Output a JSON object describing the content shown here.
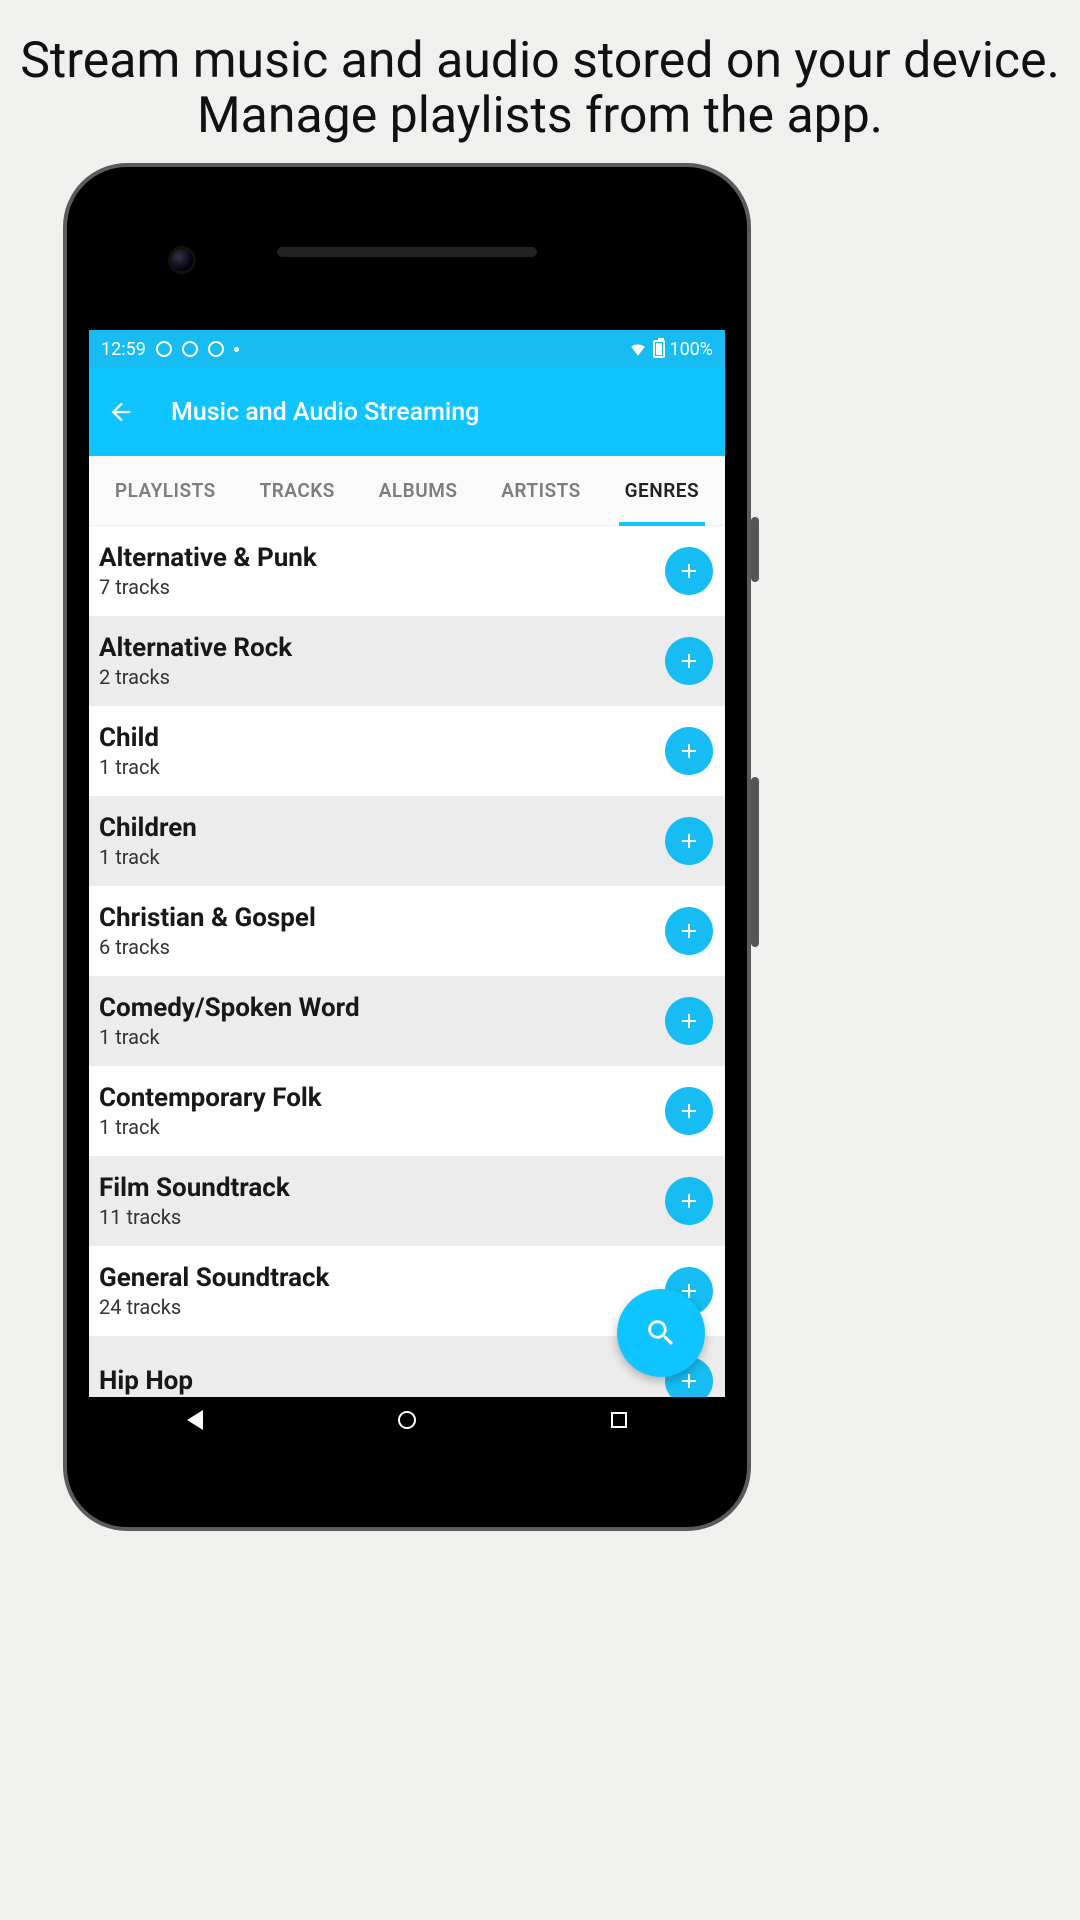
{
  "promo": "Stream music and audio stored on your device. Manage playlists from the app.",
  "statusbar": {
    "time": "12:59",
    "battery": "100%"
  },
  "appbar": {
    "title": "Music and Audio Streaming"
  },
  "tabs": [
    {
      "label": "PLAYLISTS",
      "active": false
    },
    {
      "label": "TRACKS",
      "active": false
    },
    {
      "label": "ALBUMS",
      "active": false
    },
    {
      "label": "ARTISTS",
      "active": false
    },
    {
      "label": "GENRES",
      "active": true
    }
  ],
  "genres": [
    {
      "name": "Alternative & Punk",
      "sub": "7 tracks"
    },
    {
      "name": "Alternative Rock",
      "sub": "2 tracks"
    },
    {
      "name": "Child",
      "sub": "1 track"
    },
    {
      "name": "Children",
      "sub": "1 track"
    },
    {
      "name": "Christian & Gospel",
      "sub": "6 tracks"
    },
    {
      "name": "Comedy/Spoken Word",
      "sub": "1 track"
    },
    {
      "name": "Contemporary Folk",
      "sub": "1 track"
    },
    {
      "name": "Film Soundtrack",
      "sub": "11 tracks"
    },
    {
      "name": "General Soundtrack",
      "sub": "24 tracks"
    },
    {
      "name": "Hip Hop",
      "sub": ""
    }
  ]
}
